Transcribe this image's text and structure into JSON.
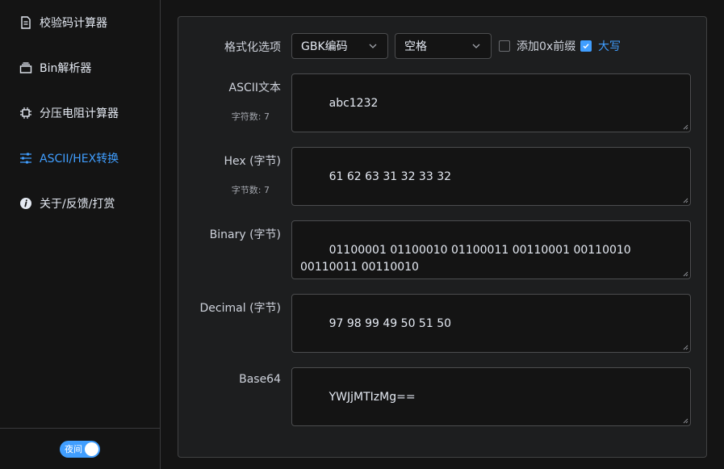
{
  "sidebar": {
    "items": [
      {
        "label": "校验码计算器",
        "icon": "document-icon",
        "active": false
      },
      {
        "label": "Bin解析器",
        "icon": "stack-icon",
        "active": false
      },
      {
        "label": "分压电阻计算器",
        "icon": "chip-icon",
        "active": false
      },
      {
        "label": "ASCII/HEX转换",
        "icon": "sliders-icon",
        "active": true
      },
      {
        "label": "关于/反馈/打赏",
        "icon": "info-icon",
        "active": false
      }
    ],
    "theme_toggle_label": "夜间"
  },
  "form": {
    "format_label": "格式化选项",
    "encoding_value": "GBK编码",
    "separator_value": "空格",
    "prefix_checkbox": {
      "label": "添加0x前缀",
      "checked": false
    },
    "uppercase_checkbox": {
      "label": "大写",
      "checked": true
    },
    "ascii": {
      "label": "ASCII文本",
      "count": "字符数: 7",
      "value": "abc1232"
    },
    "hex": {
      "label": "Hex (字节)",
      "count": "字节数: 7",
      "value": "61 62 63 31 32 33 32"
    },
    "binary": {
      "label": "Binary (字节)",
      "value": "01100001 01100010 01100011 00110001 00110010 00110011 00110010"
    },
    "decimal": {
      "label": "Decimal (字节)",
      "value": "97 98 99 49 50 51 50"
    },
    "base64": {
      "label": "Base64",
      "value": "YWJjMTIzMg=="
    }
  },
  "colors": {
    "accent": "#409eff",
    "background": "#141414",
    "card": "#1d1e1f"
  }
}
